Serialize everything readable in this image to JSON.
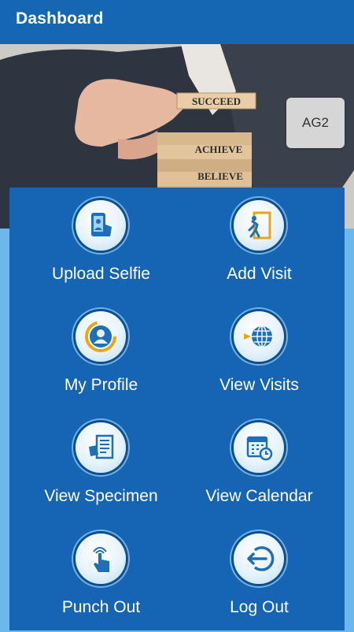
{
  "app": {
    "title": "Dashboard"
  },
  "hero": {
    "blocks": [
      "SUCCEED",
      "ACHIEVE",
      "BELIEVE"
    ],
    "badge": "AG2"
  },
  "menu": [
    {
      "label": "Upload Selfie",
      "icon": "selfie-phone-icon"
    },
    {
      "label": "Add Visit",
      "icon": "door-walk-icon"
    },
    {
      "label": "My Profile",
      "icon": "profile-avatar-icon"
    },
    {
      "label": "View Visits",
      "icon": "globe-arrow-icon"
    },
    {
      "label": "View Specimen",
      "icon": "document-hand-icon"
    },
    {
      "label": "View Calendar",
      "icon": "calendar-clock-icon"
    },
    {
      "label": "Punch Out",
      "icon": "touch-finger-icon"
    },
    {
      "label": "Log Out",
      "icon": "logout-arrow-icon"
    }
  ],
  "colors": {
    "appbar": "#1667b3",
    "panel": "#1565b4",
    "background": "#6cb8ec"
  }
}
